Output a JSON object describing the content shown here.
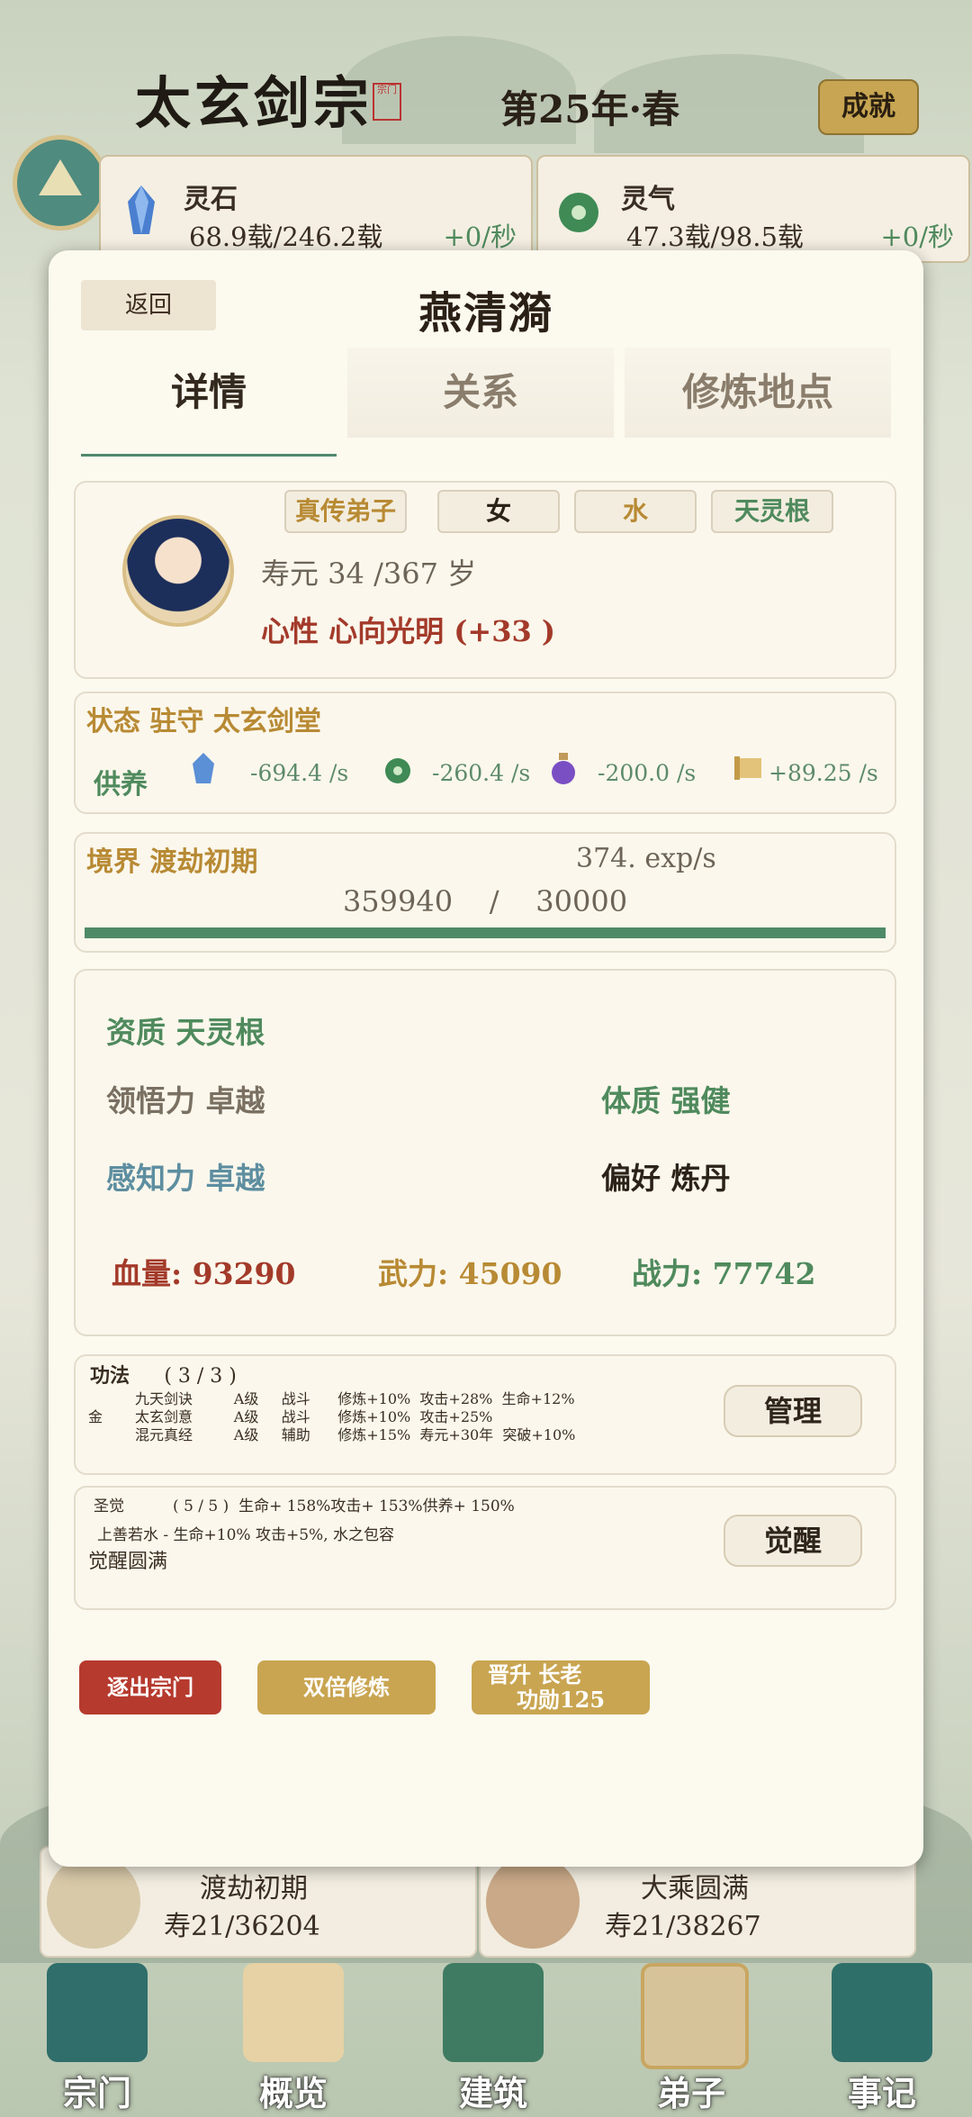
{
  "header": {
    "sect_name": "太玄剑宗",
    "seal_text": "宗门",
    "season": "第25年·春",
    "achievement_label": "成就"
  },
  "resources": [
    {
      "name": "灵石",
      "value": "68.9载/246.2载",
      "rate": "+0/秒",
      "icon": "blue-crystal-icon"
    },
    {
      "name": "灵气",
      "value": "47.3载/98.5载",
      "rate": "+0/秒",
      "icon": "green-jade-icon"
    }
  ],
  "modal": {
    "back_label": "返回",
    "name": "燕清漪",
    "tabs": [
      "详情",
      "关系",
      "修炼地点"
    ],
    "active_tab": 0,
    "tags": [
      "真传弟子",
      "女",
      "水",
      "天灵根"
    ],
    "lifespan": "寿元 34 /367 岁",
    "mind": "心性  心向光明 (+33 )",
    "status": "状态  驻守  太玄剑堂",
    "supply_label": "供养",
    "supplies": [
      {
        "icon": "spirit-stone-icon",
        "value": "-694.4 /s"
      },
      {
        "icon": "spirit-jade-icon",
        "value": "-260.4 /s"
      },
      {
        "icon": "potion-icon",
        "value": "-200.0 /s"
      },
      {
        "icon": "scroll-icon",
        "value": "+89.25   /s"
      }
    ],
    "realm": "境界  渡劫初期",
    "exp_rate": "374. exp/s",
    "exp_current": "359940",
    "exp_sep": "/",
    "exp_required": "30000",
    "exp_progress": 1.0,
    "aptitude": "资质  天灵根",
    "comprehension": "领悟力 卓越",
    "constitution": "体质  强健",
    "perception": "感知力 卓越",
    "preference": "偏好   炼丹",
    "hp": "血量: 93290",
    "force": "武力: 45090",
    "power": "战力: 77742",
    "kungfu_title": "功法",
    "kungfu_count": "( 3 / 3 )",
    "element": "金",
    "kungfu_rows": [
      "九天剑诀         A级     战斗      修炼+10%  攻击+28%  生命+12%",
      "太玄剑意         A级     战斗      修炼+10%  攻击+25%",
      "混元真经         A级     辅助      修炼+15%  寿元+30年  突破+10%"
    ],
    "manage_label": "管理",
    "awaken_header": "圣觉          ( 5 / 5 )  生命+ 158%攻击+ 153%供养+ 150%",
    "awaken_detail": "上善若水  -  生命+10% 攻击+5%, 水之包容",
    "awaken_complete": "觉醒圆满",
    "awaken_label": "觉醒",
    "expel_label": "逐出宗门",
    "double_label": "双倍修炼",
    "promote_label": "晋升 长老",
    "promote_cost": "功勋125"
  },
  "background_cards": [
    {
      "realm": "渡劫初期",
      "lifespan": "寿21/36204"
    },
    {
      "realm": "大乘圆满",
      "lifespan": "寿21/38267"
    }
  ],
  "nav": [
    "宗门",
    "概览",
    "建筑",
    "弟子",
    "事记"
  ],
  "active_nav": 3,
  "colors": {
    "accent_green": "#4f8a66",
    "gold": "#b88a34",
    "red": "#a33a2a",
    "expel_red": "#b63a2e",
    "button_gold": "#c9a551"
  }
}
